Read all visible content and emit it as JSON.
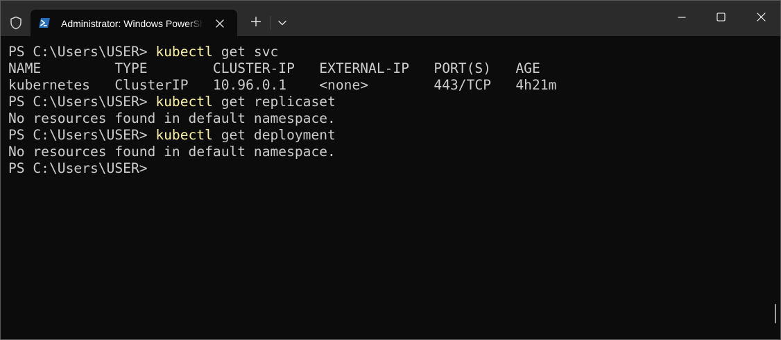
{
  "window": {
    "tab_title": "Administrator: Windows PowerShell",
    "icons": {
      "admin": "shield-icon",
      "tab": "powershell-icon",
      "tab_close": "close-icon",
      "new_tab": "plus-icon",
      "dropdown": "chevron-down-icon",
      "minimize": "minimize-icon",
      "maximize": "maximize-icon",
      "close": "close-icon"
    }
  },
  "colors": {
    "titlebar": "#2b2b2b",
    "terminal_bg": "#0c0c0c",
    "text": "#cccccc",
    "command": "#f9f1a5"
  },
  "terminal": {
    "lines": [
      {
        "prompt": "PS C:\\Users\\USER> ",
        "command": "kubectl",
        "args": " get svc"
      },
      {
        "text": "NAME         TYPE        CLUSTER-IP   EXTERNAL-IP   PORT(S)   AGE"
      },
      {
        "text": "kubernetes   ClusterIP   10.96.0.1    <none>        443/TCP   4h21m"
      },
      {
        "prompt": "PS C:\\Users\\USER> ",
        "command": "kubectl",
        "args": " get replicaset"
      },
      {
        "text": "No resources found in default namespace."
      },
      {
        "prompt": "PS C:\\Users\\USER> ",
        "command": "kubectl",
        "args": " get deployment"
      },
      {
        "text": "No resources found in default namespace."
      },
      {
        "prompt": "PS C:\\Users\\USER>",
        "command": "",
        "args": ""
      }
    ]
  }
}
